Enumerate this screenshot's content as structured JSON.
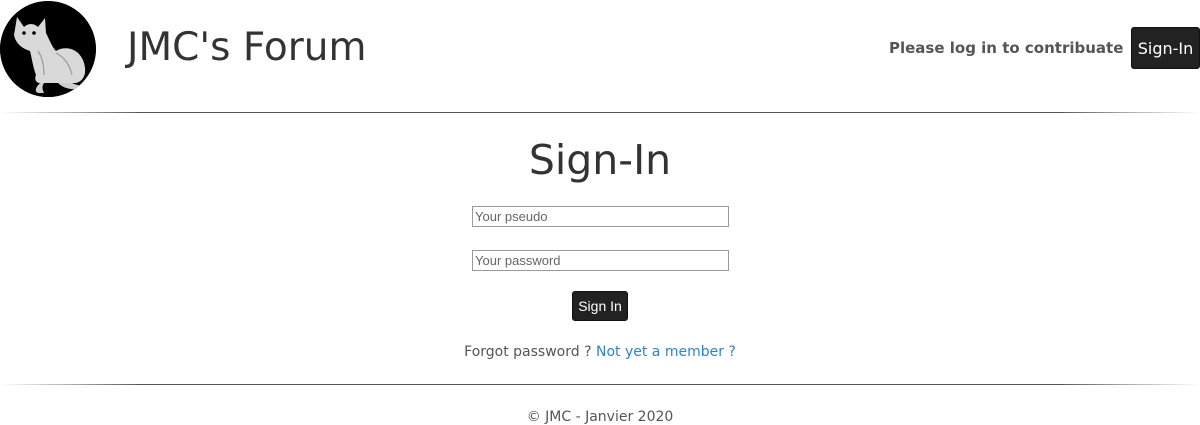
{
  "header": {
    "site_title": "JMC's Forum",
    "login_hint": "Please log in to contribuate",
    "signin_button_label": "Sign-In",
    "logo_icon": "cat-logo-icon"
  },
  "main": {
    "title": "Sign-In",
    "pseudo_placeholder": "Your pseudo",
    "password_placeholder": "Your password",
    "submit_label": "Sign In",
    "forgot_password": "Forgot password ?",
    "member_link": "Not yet a member ?"
  },
  "footer": {
    "text": "© JMC - Janvier 2020"
  },
  "colors": {
    "button_bg": "#222222",
    "link": "#2f80d6",
    "text": "#333333"
  }
}
